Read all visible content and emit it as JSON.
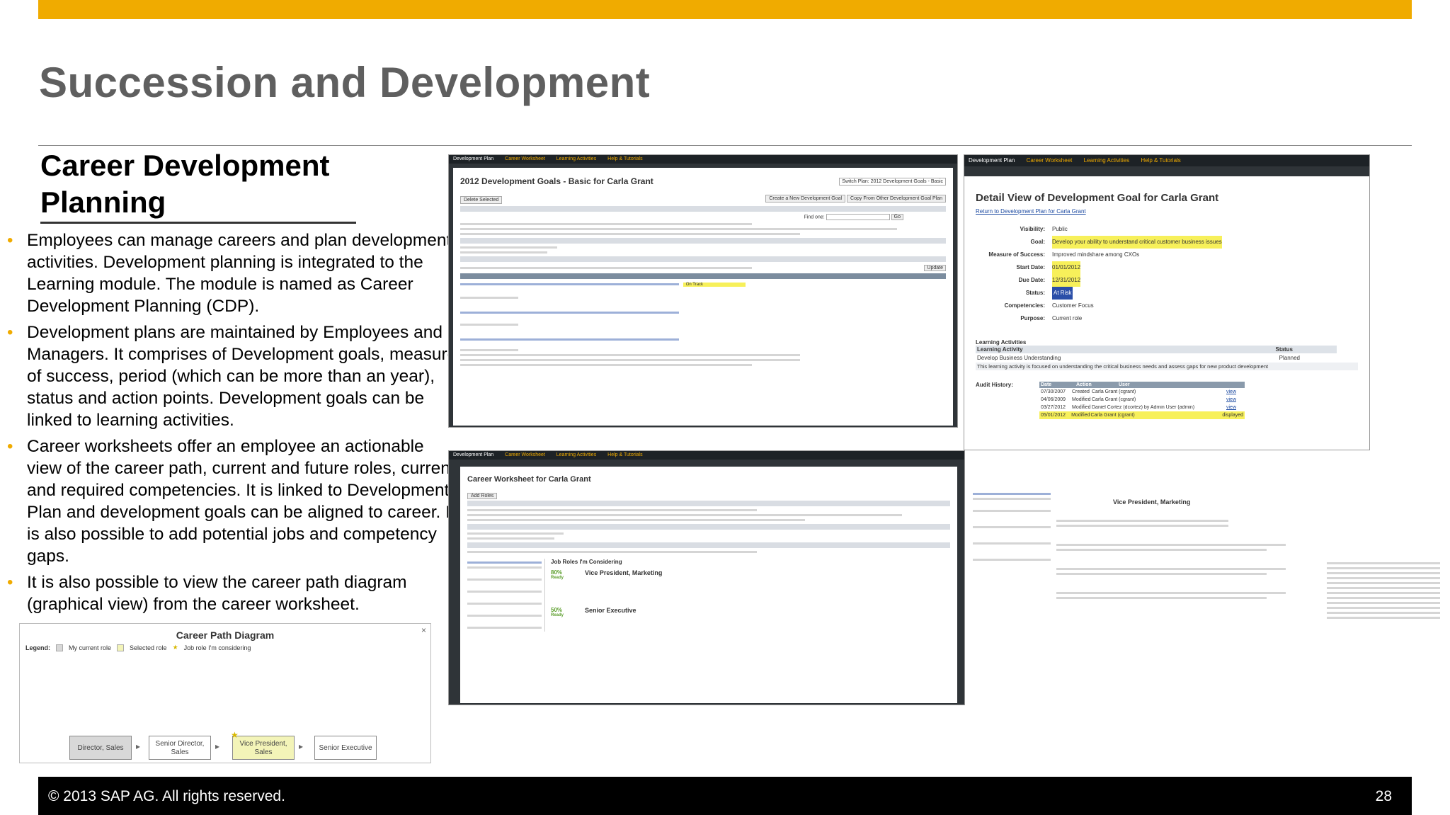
{
  "slide": {
    "title": "Succession and Development",
    "subtitle": "Career Development Planning",
    "bullets": [
      "Employees can manage careers and plan development activities. Development planning is integrated to the Learning module. The module is named as Career Development Planning (CDP).",
      "Development plans are maintained by Employees and Managers. It comprises of Development goals, measure of success, period (which can be more than an year), status and action points. Development goals can be linked to learning activities.",
      "Career worksheets offer an employee an actionable view of the career path, current and future roles, current and required competencies. It is linked to Development Plan and development goals can be aligned to career. It is also possible to add potential jobs and competency gaps.",
      "It is also possible to view the career path diagram (graphical view) from the career worksheet."
    ],
    "footer_copyright": "© 2013 SAP AG. All rights reserved.",
    "page_number": "28",
    "accent_color": "#f0ab00"
  },
  "nav": {
    "tabs": [
      "Development Plan",
      "Career Worksheet",
      "Learning Activities",
      "Help & Tutorials"
    ]
  },
  "dev_plan": {
    "title": "2012 Development Goals - Basic for Carla Grant",
    "switch_label": "Switch Plan: 2012 Development Goals - Basic",
    "delete_button": "Delete Selected",
    "create_button": "Create a New Development Goal",
    "copy_button": "Copy From Other Development Goal Plan",
    "find_label": "Find one:",
    "go_button": "Go",
    "status_on_track": "On Track",
    "update_button": "Update"
  },
  "goal_detail": {
    "title": "Detail View of Development Goal for Carla Grant",
    "return_link": "Return to Development Plan for Carla Grant",
    "fields": [
      {
        "label": "Visibility:",
        "value": "Public"
      },
      {
        "label": "Goal:",
        "value": "Develop your ability to understand critical customer business issues"
      },
      {
        "label": "Measure of Success:",
        "value": "Improved mindshare among CXOs"
      },
      {
        "label": "Start Date:",
        "value": "01/01/2012"
      },
      {
        "label": "Due Date:",
        "value": "12/31/2012"
      },
      {
        "label": "Status:",
        "value": "At Risk"
      },
      {
        "label": "Competencies:",
        "value": "Customer Focus"
      },
      {
        "label": "Purpose:",
        "value": "Current role"
      }
    ],
    "learning_heading": "Learning Activities",
    "learning_col1": "Learning Activity",
    "learning_col2": "Status",
    "learning_activity": "Develop Business Understanding",
    "learning_status": "Planned",
    "learning_desc": "This learning activity is focused on understanding the critical business needs and assess gaps for new product development",
    "audit_label": "Audit History:",
    "audit_cols": [
      "Date",
      "Action",
      "User"
    ],
    "audit_rows": [
      [
        "07/30/2007",
        "Created",
        "Carla Grant (cgrant)",
        "view"
      ],
      [
        "04/06/2009",
        "Modified",
        "Carla Grant (cgrant)",
        "view"
      ],
      [
        "03/27/2012",
        "Modified",
        "Daniel Cortez (dcortez) by Admin User (admin)",
        "view"
      ],
      [
        "05/01/2012",
        "Modified",
        "Carla Grant (cgrant)",
        "displayed"
      ]
    ]
  },
  "worksheet": {
    "title": "Career Worksheet for Carla Grant",
    "add_roles_button": "Add Roles",
    "roles_heading": "Job Roles I'm Considering",
    "role1": "Vice President, Marketing",
    "role1_pct": "80%",
    "role2": "Senior Executive",
    "role2_pct": "50%",
    "ready_label": "Ready"
  },
  "career_path": {
    "title": "Career Path Diagram",
    "legend_label": "Legend:",
    "legend_items": [
      "My current role",
      "Selected role",
      "Job role I'm considering"
    ],
    "nodes": [
      "Director, Sales",
      "Senior Director, Sales",
      "Vice President, Sales",
      "Senior Executive"
    ]
  }
}
